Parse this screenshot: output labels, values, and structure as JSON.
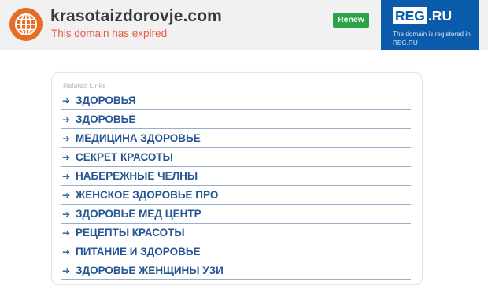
{
  "header": {
    "domain": "krasotaizdorovje.com",
    "status": "This domain has expired",
    "renew_label": "Renew",
    "icon": "globe-icon"
  },
  "registrar": {
    "logo_box": "REG",
    "logo_rest": ".RU",
    "description": "The domain is registered in REG.RU"
  },
  "related": {
    "title": "Related Links",
    "arrow": "➔",
    "links": [
      "ЗДОРОВЬЯ",
      "ЗДОРОВЬЕ",
      "МЕДИЦИНА ЗДОРОВЬЕ",
      "СЕКРЕТ КРАСОТЫ",
      "НАБЕРЕЖНЫЕ ЧЕЛНЫ",
      "ЖЕНСКОЕ ЗДОРОВЬЕ ПРО",
      "ЗДОРОВЬЕ МЕД ЦЕНТР",
      "РЕЦЕПТЫ КРАСОТЫ",
      "ПИТАНИЕ И ЗДОРОВЬЕ",
      "ЗДОРОВЬЕ ЖЕНЩИНЫ УЗИ"
    ]
  },
  "colors": {
    "header_bg": "#f1f1f1",
    "globe": "#e46e26",
    "expired": "#ec5a47",
    "renew": "#2aa449",
    "registrar_bg": "#0a5ba9",
    "link": "#255593"
  }
}
